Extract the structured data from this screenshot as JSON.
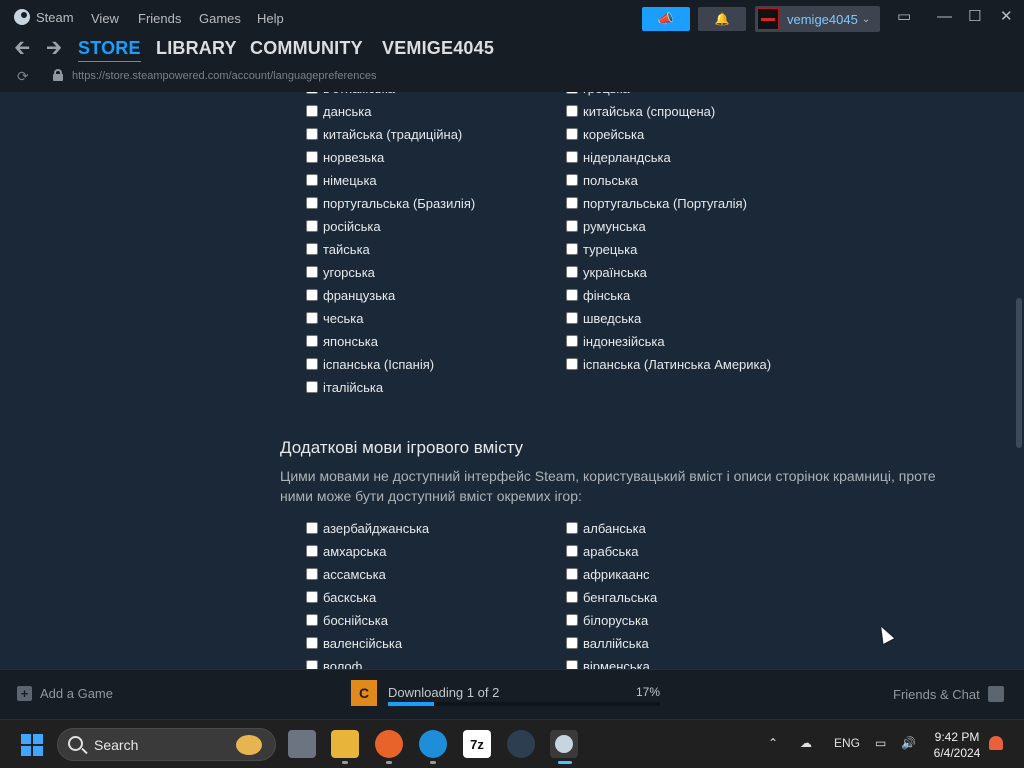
{
  "menubar": {
    "app_name": "Steam",
    "items": [
      "View",
      "Friends",
      "Games",
      "Help"
    ],
    "account_name": "vemige4045"
  },
  "nav": {
    "tabs": [
      "STORE",
      "LIBRARY",
      "COMMUNITY",
      "VEMIGE4045"
    ],
    "active_tab": "STORE"
  },
  "url": "https://store.steampowered.com/account/languagepreferences",
  "interface_languages": {
    "partial_top_left": "в'єтнамська",
    "partial_top_right": "грецька",
    "left": [
      "данська",
      "китайська (традиційна)",
      "норвезька",
      "німецька",
      "португальська (Бразилія)",
      "російська",
      "тайська",
      "угорська",
      "французька",
      "чеська",
      "японська",
      "іспанська (Іспанія)",
      "італійська"
    ],
    "right": [
      "китайська (спрощена)",
      "корейська",
      "нідерландська",
      "польська",
      "португальська (Португалія)",
      "румунська",
      "турецька",
      "українська",
      "фінська",
      "шведська",
      "індонезійська",
      "іспанська (Латинська Америка)"
    ]
  },
  "additional_section": {
    "title": "Додаткові мови ігрового вмісту",
    "description": "Цими мовами не доступний інтерфейс Steam, користувацький вміст і описи сторінок крамниці, проте ними може бути доступний вміст окремих ігор:",
    "left": [
      "азербайджанська",
      "амхарська",
      "ассамська",
      "баскська",
      "боснійська",
      "валенсійська",
      "волоф"
    ],
    "right": [
      "албанська",
      "арабська",
      "африкаанс",
      "бенгальська",
      "білоруська",
      "валлійська",
      "вірменська"
    ]
  },
  "footer": {
    "add_game": "Add a Game",
    "download_status": "Downloading 1 of 2",
    "download_percent": "17%",
    "download_progress": 0.17,
    "friends_chat": "Friends & Chat"
  },
  "taskbar": {
    "search_placeholder": "Search",
    "language": "ENG",
    "time": "9:42 PM",
    "date": "6/4/2024",
    "archiver_label": "7z"
  },
  "colors": {
    "accent": "#1a9fff",
    "content_bg": "#1b2838",
    "chrome_bg": "#171d25"
  }
}
